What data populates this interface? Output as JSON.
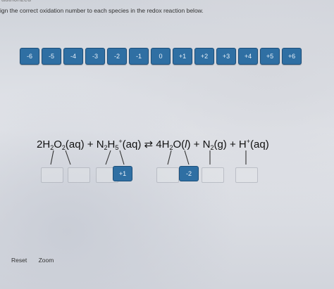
{
  "header": {
    "status": "authorized",
    "instruction": "ign the correct oxidation number to each species in the redox reaction below."
  },
  "tiles": [
    "-6",
    "-5",
    "-4",
    "-3",
    "-2",
    "-1",
    "0",
    "+1",
    "+2",
    "+3",
    "+4",
    "+5",
    "+6"
  ],
  "equation": {
    "h2o2": "2H",
    "h2o2_sub1": "2",
    "h2o2_o": "O",
    "h2o2_sub2": "2",
    "h2o2_state": "(aq)",
    "plus1": " + ",
    "n2h5_n": "N",
    "n2h5_sub1": "2",
    "n2h5_h": "H",
    "n2h5_sub2": "5",
    "n2h5_sup": "+",
    "n2h5_state": "(aq)",
    "arrow": " ⇄ ",
    "h2o": "4H",
    "h2o_sub": "2",
    "h2o_o": "O(",
    "h2o_state_l": "l",
    "h2o_state_end": ")",
    "plus2": " + ",
    "n2": "N",
    "n2_sub": "2",
    "n2_state": "(g)",
    "plus3": " + ",
    "hplus": "H",
    "hplus_sup": "+",
    "hplus_state": "(aq)"
  },
  "placed": {
    "n_in_n2h5": "+1",
    "o_in_h2o": "-2"
  },
  "footer": {
    "reset": "Reset",
    "zoom": "Zoom"
  },
  "colors": {
    "tile": "#2f6fa3",
    "tile_text": "#e9f2fb"
  }
}
